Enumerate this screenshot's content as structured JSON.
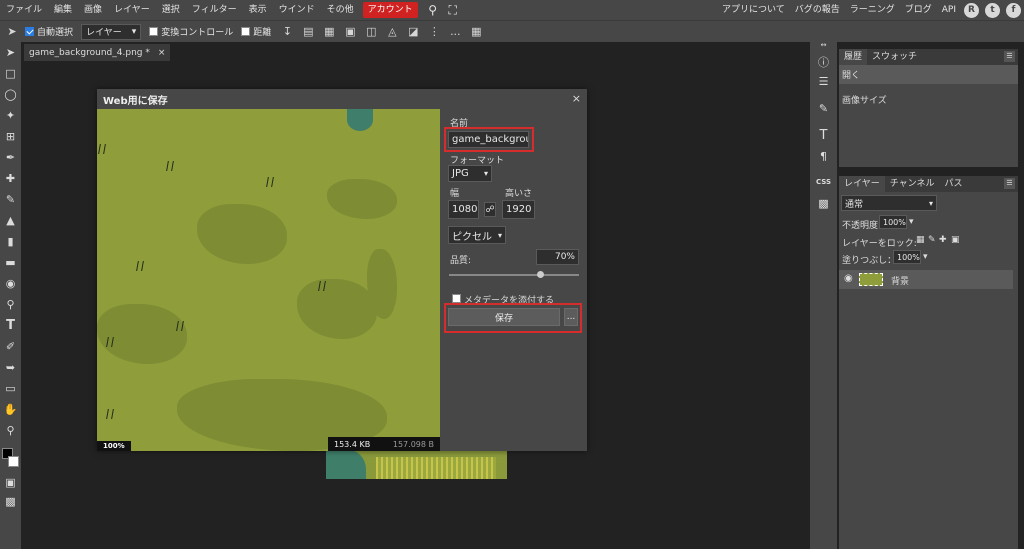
{
  "menubar": {
    "items": [
      "ファイル",
      "編集",
      "画像",
      "レイヤー",
      "選択",
      "フィルター",
      "表示",
      "ウインド",
      "その他"
    ],
    "account": "アカウント",
    "right_items": [
      "アプリについて",
      "バグの報告",
      "ラーニング",
      "ブログ",
      "API"
    ],
    "social": [
      "R",
      "t",
      "f"
    ]
  },
  "optbar": {
    "auto_select": "自動選択",
    "layer_select": "レイヤー",
    "transform": "変換コントロール",
    "distance": "距離",
    "more": "..."
  },
  "doc_tab": {
    "name": "game_background_4.png *",
    "close": "×"
  },
  "dialog": {
    "title": "Web用に保存",
    "close": "×",
    "name_label": "名前",
    "name_value": "game_backgrou",
    "format_label": "フォーマット",
    "format_value": "JPG",
    "width_label": "幅",
    "width_value": "1080",
    "height_label": "高いさ",
    "height_value": "1920",
    "unit_value": "ピクセル",
    "quality_label": "品質:",
    "quality_value": "70%",
    "quality_fraction": 0.7,
    "metadata_label": "メタデータを添付する",
    "save_button": "保存",
    "more_button": "...",
    "zoom": "100%",
    "file_size": "153.4 KB",
    "file_bytes": "157.098 B"
  },
  "panels": {
    "history_tabs": [
      "履歴",
      "スウォッチ"
    ],
    "history_items": [
      "開く",
      "画像サイズ"
    ],
    "layer_tabs": [
      "レイヤー",
      "チャンネル",
      "パス"
    ],
    "blend_mode": "通常",
    "opacity_label": "不透明度:",
    "opacity_value": "100%",
    "lock_label": "レイヤーをロック:",
    "fill_label": "塗りつぶし：",
    "fill_value": "100%",
    "layer_name": "背景"
  },
  "colors": {
    "accent": "#d12222",
    "highlight_box": "#d62c2c",
    "canvas_green": "#8f9d3b"
  }
}
